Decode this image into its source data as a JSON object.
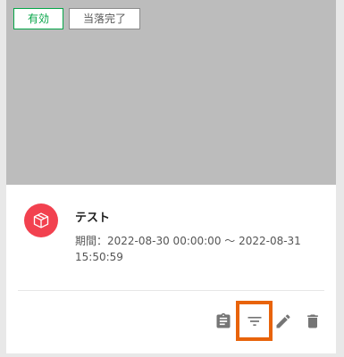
{
  "badges": {
    "active": "有効",
    "done": "当落完了"
  },
  "campaign": {
    "title": "テスト",
    "period": "期間：2022-08-30 00:00:00 〜 2022-08-31 15:50:59"
  },
  "icons": {
    "campaign": "box-icon",
    "actions": [
      "clipboard-icon",
      "filter-icon",
      "pencil-icon",
      "trash-icon"
    ]
  },
  "colors": {
    "active": "#06a548",
    "brand": "#f2414f",
    "highlight": "#e8630a",
    "icon": "#757575"
  }
}
